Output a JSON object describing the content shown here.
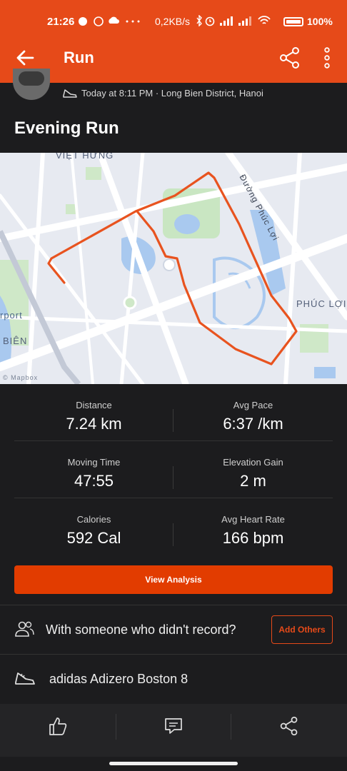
{
  "status_bar": {
    "time": "21:26",
    "left_icons": "messenger-icon viber-icon cloud-icon ···",
    "network_speed": "0,2KB/s",
    "right_icons": "bluetooth-icon alarm-icon signal-icon signal-icon wifi-icon",
    "battery": "100%"
  },
  "app_bar": {
    "title": "Run",
    "back_icon": "arrow-left-icon",
    "share_icon": "share-icon",
    "more_icon": "more-vertical-icon"
  },
  "activity": {
    "meta": "Today at 8:11 PM · Long Bien District, Hanoi",
    "title": "Evening Run"
  },
  "map": {
    "labels": [
      "VIỆT HƯNG",
      "Đường Phúc Lợi",
      "PHÚC LỢI",
      "rport",
      "BIÊN"
    ],
    "credit": "© Mapbox",
    "route_color": "#e8531f"
  },
  "stats": [
    {
      "label": "Distance",
      "value": "7.24 km"
    },
    {
      "label": "Avg Pace",
      "value": "6:37 /km"
    },
    {
      "label": "Moving Time",
      "value": "47:55"
    },
    {
      "label": "Elevation Gain",
      "value": "2 m"
    },
    {
      "label": "Calories",
      "value": "592 Cal"
    },
    {
      "label": "Avg Heart Rate",
      "value": "166 bpm"
    }
  ],
  "analysis_button": "View Analysis",
  "someone": {
    "text": "With someone who didn't record?",
    "button": "Add Others"
  },
  "gear": {
    "text": "adidas Adizero Boston 8"
  },
  "bottom_bar": {
    "like_icon": "thumbs-up-icon",
    "comment_icon": "comment-icon",
    "share_icon": "share-icon"
  },
  "colors": {
    "accent": "#e64a19",
    "button": "#e23c00",
    "background": "#1c1c1e"
  }
}
